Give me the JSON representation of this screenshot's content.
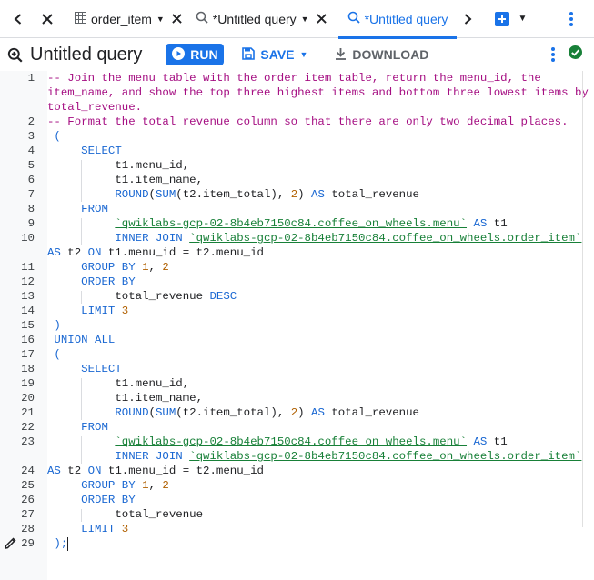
{
  "tabs": [
    {
      "label": "order_item",
      "icon": "table-icon",
      "active": false
    },
    {
      "label": "*Untitled query",
      "icon": "query-icon",
      "active": false
    },
    {
      "label": "*Untitled query",
      "icon": "query-icon",
      "active": true
    }
  ],
  "toolbar": {
    "title": "Untitled query",
    "run_label": "RUN",
    "save_label": "SAVE",
    "download_label": "DOWNLOAD"
  },
  "colors": {
    "accent": "#1a73e8",
    "comment": "#a50e82",
    "keyword": "#1967d2",
    "number": "#b06000",
    "table_ref": "#188038",
    "status_ok": "#188038"
  },
  "editor": {
    "line_numbers": [
      "1",
      "2",
      "3",
      "4",
      "5",
      "6",
      "7",
      "8",
      "9",
      "10",
      "11",
      "12",
      "13",
      "14",
      "15",
      "16",
      "17",
      "18",
      "19",
      "20",
      "21",
      "22",
      "23",
      "24",
      "25",
      "26",
      "27",
      "28",
      "29"
    ],
    "code_lines": [
      {
        "parts": [
          [
            "cm",
            "-- Join the menu table with the order item table, return the menu_id, the"
          ]
        ]
      },
      {
        "parts": [
          [
            "cm",
            "item_name, and show the top three highest items and bottom three lowest items by"
          ]
        ]
      },
      {
        "parts": [
          [
            "cm",
            "total_revenue."
          ]
        ]
      },
      {
        "parts": [
          [
            "cm",
            "-- Format the total revenue column so that there are only two decimal places."
          ]
        ]
      },
      {
        "parts": [
          [
            "kw",
            " ("
          ]
        ]
      },
      {
        "parts": [
          [
            "kw",
            "     SELECT"
          ]
        ]
      },
      {
        "parts": [
          [
            "pl",
            "          t1.menu_id,"
          ]
        ]
      },
      {
        "parts": [
          [
            "pl",
            "          t1.item_name,"
          ]
        ]
      },
      {
        "parts": [
          [
            "fn",
            "          ROUND"
          ],
          [
            "pl",
            "("
          ],
          [
            "fn",
            "SUM"
          ],
          [
            "pl",
            "(t2.item_total), "
          ],
          [
            "num",
            "2"
          ],
          [
            "pl",
            ") "
          ],
          [
            "kw",
            "AS"
          ],
          [
            "pl",
            " total_revenue"
          ]
        ]
      },
      {
        "parts": [
          [
            "kw",
            "     FROM"
          ]
        ]
      },
      {
        "parts": [
          [
            "pl",
            "          "
          ],
          [
            "tbl",
            "`qwiklabs-gcp-02-8b4eb7150c84.coffee_on_wheels.menu`"
          ],
          [
            "pl",
            " "
          ],
          [
            "kw",
            "AS"
          ],
          [
            "pl",
            " t1"
          ]
        ]
      },
      {
        "parts": [
          [
            "pl",
            "          "
          ],
          [
            "kw",
            "INNER JOIN"
          ],
          [
            "pl",
            " "
          ],
          [
            "tbl",
            "`qwiklabs-gcp-02-8b4eb7150c84.coffee_on_wheels.order_item`"
          ]
        ]
      },
      {
        "parts": [
          [
            "kw",
            "AS"
          ],
          [
            "pl",
            " t2 "
          ],
          [
            "kw",
            "ON"
          ],
          [
            "pl",
            " t1.menu_id = t2.menu_id"
          ]
        ]
      },
      {
        "parts": [
          [
            "kw",
            "     GROUP BY"
          ],
          [
            "pl",
            " "
          ],
          [
            "num",
            "1"
          ],
          [
            "pl",
            ", "
          ],
          [
            "num",
            "2"
          ]
        ]
      },
      {
        "parts": [
          [
            "kw",
            "     ORDER BY"
          ]
        ]
      },
      {
        "parts": [
          [
            "pl",
            "          total_revenue "
          ],
          [
            "kw",
            "DESC"
          ]
        ]
      },
      {
        "parts": [
          [
            "kw",
            "     LIMIT"
          ],
          [
            "pl",
            " "
          ],
          [
            "num",
            "3"
          ]
        ]
      },
      {
        "parts": [
          [
            "kw",
            " )"
          ]
        ]
      },
      {
        "parts": [
          [
            "kw",
            " UNION ALL"
          ]
        ]
      },
      {
        "parts": [
          [
            "kw",
            " ("
          ]
        ]
      },
      {
        "parts": [
          [
            "kw",
            "     SELECT"
          ]
        ]
      },
      {
        "parts": [
          [
            "pl",
            "          t1.menu_id,"
          ]
        ]
      },
      {
        "parts": [
          [
            "pl",
            "          t1.item_name,"
          ]
        ]
      },
      {
        "parts": [
          [
            "fn",
            "          ROUND"
          ],
          [
            "pl",
            "("
          ],
          [
            "fn",
            "SUM"
          ],
          [
            "pl",
            "(t2.item_total), "
          ],
          [
            "num",
            "2"
          ],
          [
            "pl",
            ") "
          ],
          [
            "kw",
            "AS"
          ],
          [
            "pl",
            " total_revenue"
          ]
        ]
      },
      {
        "parts": [
          [
            "kw",
            "     FROM"
          ]
        ]
      },
      {
        "parts": [
          [
            "pl",
            "          "
          ],
          [
            "tbl",
            "`qwiklabs-gcp-02-8b4eb7150c84.coffee_on_wheels.menu`"
          ],
          [
            "pl",
            " "
          ],
          [
            "kw",
            "AS"
          ],
          [
            "pl",
            " t1"
          ]
        ]
      },
      {
        "parts": [
          [
            "pl",
            "          "
          ],
          [
            "kw",
            "INNER JOIN"
          ],
          [
            "pl",
            " "
          ],
          [
            "tbl",
            "`qwiklabs-gcp-02-8b4eb7150c84.coffee_on_wheels.order_item`"
          ]
        ]
      },
      {
        "parts": [
          [
            "kw",
            "AS"
          ],
          [
            "pl",
            " t2 "
          ],
          [
            "kw",
            "ON"
          ],
          [
            "pl",
            " t1.menu_id = t2.menu_id"
          ]
        ]
      },
      {
        "parts": [
          [
            "kw",
            "     GROUP BY"
          ],
          [
            "pl",
            " "
          ],
          [
            "num",
            "1"
          ],
          [
            "pl",
            ", "
          ],
          [
            "num",
            "2"
          ]
        ]
      },
      {
        "parts": [
          [
            "kw",
            "     ORDER BY"
          ]
        ]
      },
      {
        "parts": [
          [
            "pl",
            "          total_revenue"
          ]
        ]
      },
      {
        "parts": [
          [
            "kw",
            "     LIMIT"
          ],
          [
            "pl",
            " "
          ],
          [
            "num",
            "3"
          ]
        ]
      },
      {
        "parts": [
          [
            "kw",
            " );"
          ]
        ]
      }
    ]
  }
}
